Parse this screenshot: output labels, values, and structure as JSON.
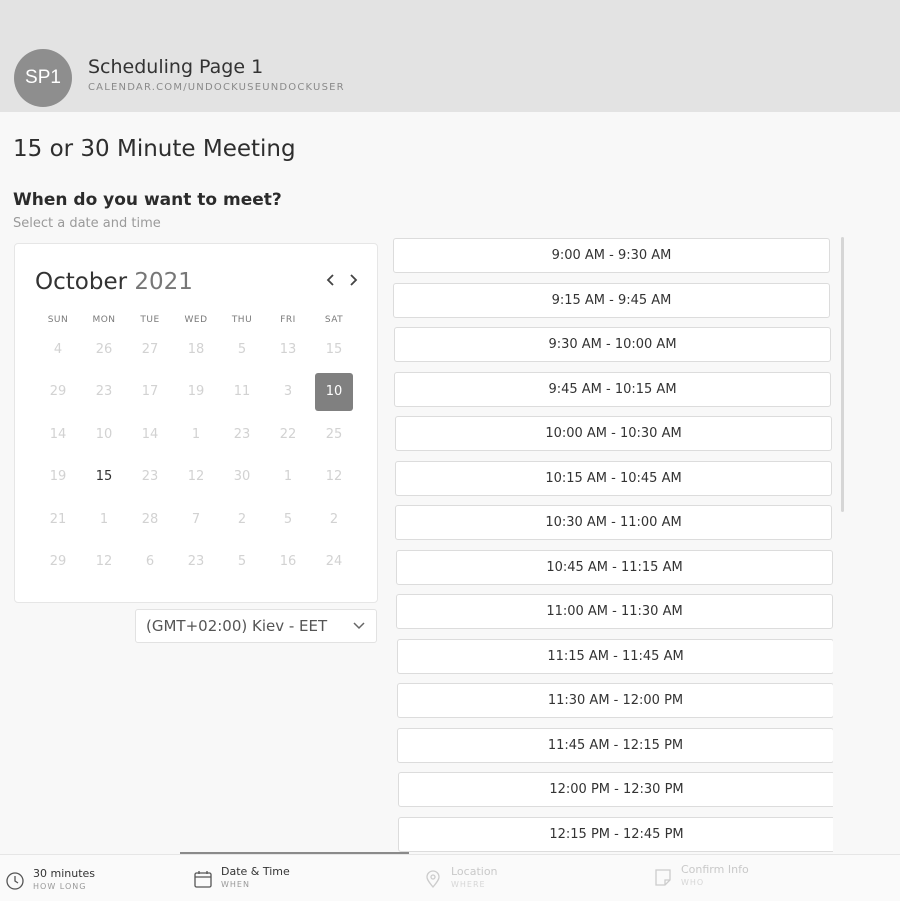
{
  "header": {
    "avatar_initials": "SP1",
    "title": "Scheduling Page 1",
    "url": "CALENDAR.COM/UNDOCKUSEUNDOCKUSER"
  },
  "meeting": {
    "title": "15 or 30 Minute Meeting",
    "question": "When do you want to meet?",
    "subtitle": "Select a date and time"
  },
  "calendar": {
    "month": "October",
    "year": "2021",
    "weekdays": [
      "SUN",
      "MON",
      "TUE",
      "WED",
      "THU",
      "FRI",
      "SAT"
    ],
    "weeks": [
      [
        {
          "d": "4"
        },
        {
          "d": "26"
        },
        {
          "d": "27"
        },
        {
          "d": "18"
        },
        {
          "d": "5"
        },
        {
          "d": "13"
        },
        {
          "d": "15"
        }
      ],
      [
        {
          "d": "29"
        },
        {
          "d": "23"
        },
        {
          "d": "17"
        },
        {
          "d": "19"
        },
        {
          "d": "11"
        },
        {
          "d": "3"
        },
        {
          "d": "10",
          "state": "selected"
        }
      ],
      [
        {
          "d": "14"
        },
        {
          "d": "10"
        },
        {
          "d": "14"
        },
        {
          "d": "1"
        },
        {
          "d": "23"
        },
        {
          "d": "22"
        },
        {
          "d": "25"
        }
      ],
      [
        {
          "d": "19"
        },
        {
          "d": "15",
          "state": "active"
        },
        {
          "d": "23"
        },
        {
          "d": "12"
        },
        {
          "d": "30"
        },
        {
          "d": "1"
        },
        {
          "d": "12"
        }
      ],
      [
        {
          "d": "21"
        },
        {
          "d": "1"
        },
        {
          "d": "28"
        },
        {
          "d": "7"
        },
        {
          "d": "2"
        },
        {
          "d": "5"
        },
        {
          "d": "2"
        }
      ],
      [
        {
          "d": "29"
        },
        {
          "d": "12"
        },
        {
          "d": "6"
        },
        {
          "d": "23"
        },
        {
          "d": "5"
        },
        {
          "d": "16"
        },
        {
          "d": "24"
        }
      ]
    ]
  },
  "timezone": {
    "value": "(GMT+02:00) Kiev - EET"
  },
  "time_slots": [
    "9:00 AM - 9:30 AM",
    "9:15 AM - 9:45 AM",
    "9:30 AM - 10:00 AM",
    "9:45 AM - 10:15 AM",
    "10:00 AM - 10:30 AM",
    "10:15 AM - 10:45 AM",
    "10:30 AM - 11:00 AM",
    "10:45 AM - 11:15 AM",
    "11:00 AM - 11:30 AM",
    "11:15 AM - 11:45 AM",
    "11:30 AM - 12:00 PM",
    "11:45 AM - 12:15 PM",
    "12:00 PM - 12:30 PM",
    "12:15 PM - 12:45 PM"
  ],
  "footer": {
    "steps": [
      {
        "label": "30 minutes",
        "sub": "HOW LONG",
        "icon": "clock-icon"
      },
      {
        "label": "Date & Time",
        "sub": "WHEN",
        "icon": "calendar-icon"
      },
      {
        "label": "Location",
        "sub": "WHERE",
        "icon": "location-pin-icon"
      },
      {
        "label": "Confirm Info",
        "sub": "WHO",
        "icon": "note-icon"
      }
    ]
  }
}
